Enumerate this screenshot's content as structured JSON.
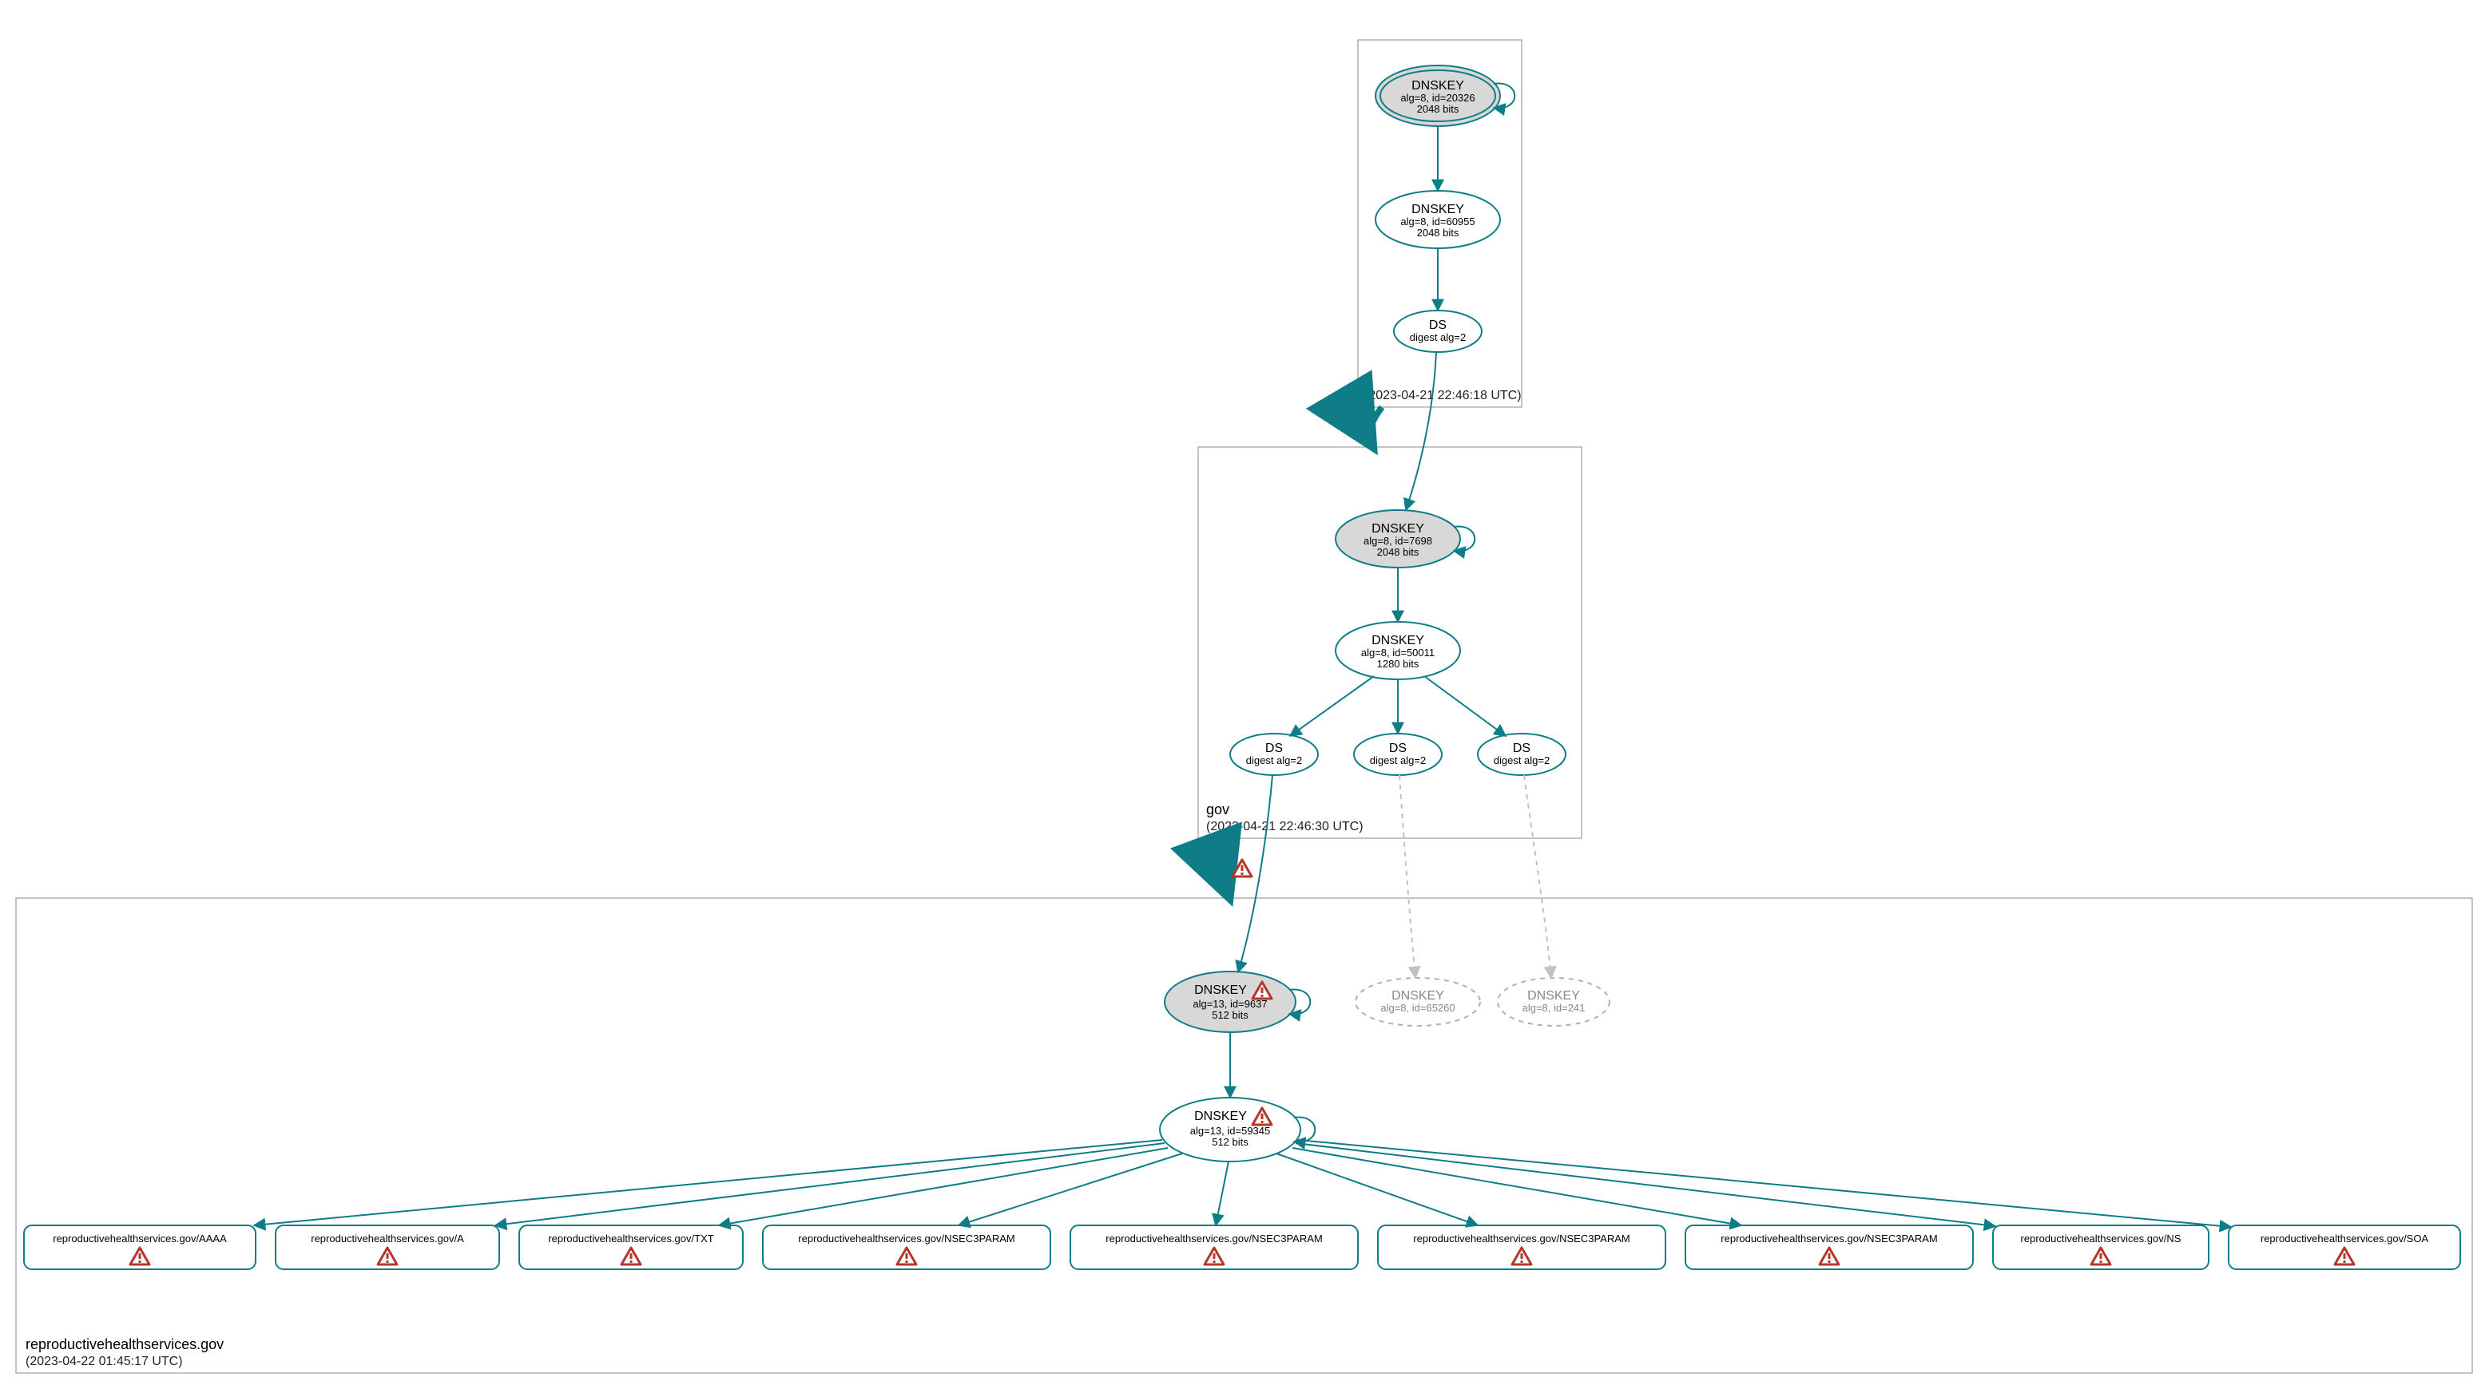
{
  "colors": {
    "stroke": "#0f7d87",
    "dashed": "#b0b0b0",
    "warn_fill": "#ffffff",
    "warn_stroke": "#c23b22"
  },
  "zones": {
    "root": {
      "label": ".",
      "timestamp": "(2023-04-21 22:46:18 UTC)"
    },
    "gov": {
      "label": "gov",
      "timestamp": "(2023-04-21 22:46:30 UTC)"
    },
    "rhs": {
      "label": "reproductivehealthservices.gov",
      "timestamp": "(2023-04-22 01:45:17 UTC)"
    }
  },
  "nodes": {
    "root_ksk": {
      "title": "DNSKEY",
      "line2": "alg=8, id=20326",
      "line3": "2048 bits"
    },
    "root_zsk": {
      "title": "DNSKEY",
      "line2": "alg=8, id=60955",
      "line3": "2048 bits"
    },
    "root_ds": {
      "title": "DS",
      "line2": "digest alg=2"
    },
    "gov_ksk": {
      "title": "DNSKEY",
      "line2": "alg=8, id=7698",
      "line3": "2048 bits"
    },
    "gov_zsk": {
      "title": "DNSKEY",
      "line2": "alg=8, id=50011",
      "line3": "1280 bits"
    },
    "gov_ds1": {
      "title": "DS",
      "line2": "digest alg=2"
    },
    "gov_ds2": {
      "title": "DS",
      "line2": "digest alg=2"
    },
    "gov_ds3": {
      "title": "DS",
      "line2": "digest alg=2"
    },
    "rhs_ksk": {
      "title": "DNSKEY",
      "line2": "alg=13, id=9637",
      "line3": "512 bits"
    },
    "rhs_dk2": {
      "title": "DNSKEY",
      "line2": "alg=8, id=65260"
    },
    "rhs_dk3": {
      "title": "DNSKEY",
      "line2": "alg=8, id=241"
    },
    "rhs_zsk": {
      "title": "DNSKEY",
      "line2": "alg=13, id=59345",
      "line3": "512 bits"
    },
    "rr_aaaa": {
      "title": "reproductivehealthservices.gov/AAAA"
    },
    "rr_a": {
      "title": "reproductivehealthservices.gov/A"
    },
    "rr_txt": {
      "title": "reproductivehealthservices.gov/TXT"
    },
    "rr_n1": {
      "title": "reproductivehealthservices.gov/NSEC3PARAM"
    },
    "rr_n2": {
      "title": "reproductivehealthservices.gov/NSEC3PARAM"
    },
    "rr_n3": {
      "title": "reproductivehealthservices.gov/NSEC3PARAM"
    },
    "rr_n4": {
      "title": "reproductivehealthservices.gov/NSEC3PARAM"
    },
    "rr_ns": {
      "title": "reproductivehealthservices.gov/NS"
    },
    "rr_soa": {
      "title": "reproductivehealthservices.gov/SOA"
    }
  }
}
